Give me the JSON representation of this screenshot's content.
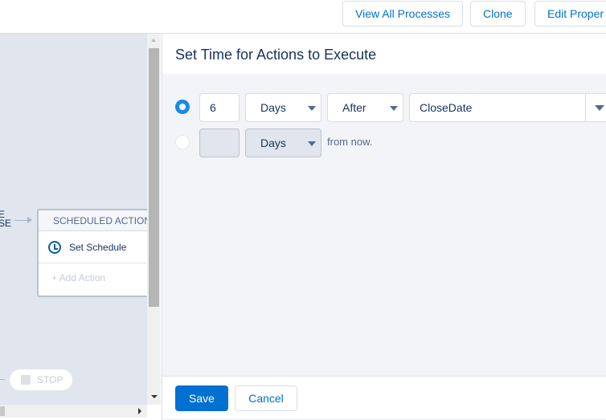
{
  "toolbar": {
    "view_all": "View All Processes",
    "clone": "Clone",
    "edit_properties": "Edit Proper"
  },
  "canvas": {
    "left_label_1": "E",
    "left_label_2": "SE",
    "card_title": "SCHEDULED ACTION",
    "set_schedule": "Set Schedule",
    "add_action": "+ Add Action",
    "stop": "STOP"
  },
  "panel": {
    "title": "Set Time for Actions to Execute",
    "row1": {
      "selected": true,
      "number": "6",
      "unit": "Days",
      "relation": "After",
      "field": "CloseDate"
    },
    "row2": {
      "selected": false,
      "number": "",
      "unit": "Days",
      "suffix": "from now."
    },
    "save": "Save",
    "cancel": "Cancel"
  },
  "colors": {
    "accent": "#0070d2",
    "radio_selected": "#1589ee"
  }
}
